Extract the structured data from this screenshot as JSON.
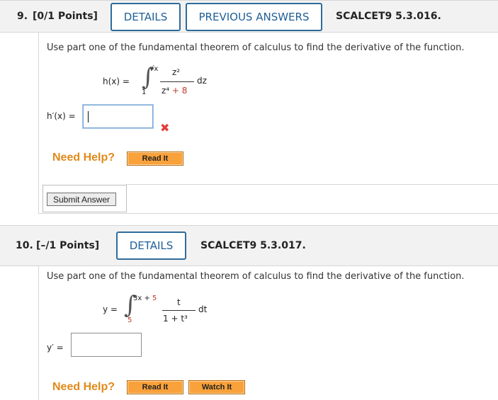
{
  "q9": {
    "number": "9.",
    "points": "[0/1 Points]",
    "details_label": "DETAILS",
    "previous_label": "PREVIOUS ANSWERS",
    "code": "SCALCET9 5.3.016.",
    "prompt": "Use part one of the fundamental theorem of calculus to find the derivative of the function.",
    "lhs": "h(x) =",
    "upper": "√x",
    "lower": "1",
    "numerator": "z²",
    "denominator_a": "z⁴",
    "denominator_b": " + 8",
    "diff": "dz",
    "answer_label": "h′(x) =",
    "answer_value": "",
    "status": "incorrect",
    "need_help": "Need Help?",
    "read_it": "Read It",
    "submit": "Submit Answer"
  },
  "q10": {
    "number": "10.",
    "points": "[–/1 Points]",
    "details_label": "DETAILS",
    "code": "SCALCET9 5.3.017.",
    "prompt": "Use part one of the fundamental theorem of calculus to find the derivative of the function.",
    "lhs": "y =",
    "upper_a": "3x + ",
    "upper_b": "5",
    "lower": "5",
    "numerator": "t",
    "denominator": "1 + t³",
    "diff": "dt",
    "answer_label": "y′ =",
    "answer_value": "",
    "need_help": "Need Help?",
    "read_it": "Read It",
    "watch_it": "Watch It"
  },
  "colors": {
    "accent": "#1f5f97",
    "help": "#e08a1a",
    "button": "#f9a13a",
    "error": "#e0403a"
  }
}
